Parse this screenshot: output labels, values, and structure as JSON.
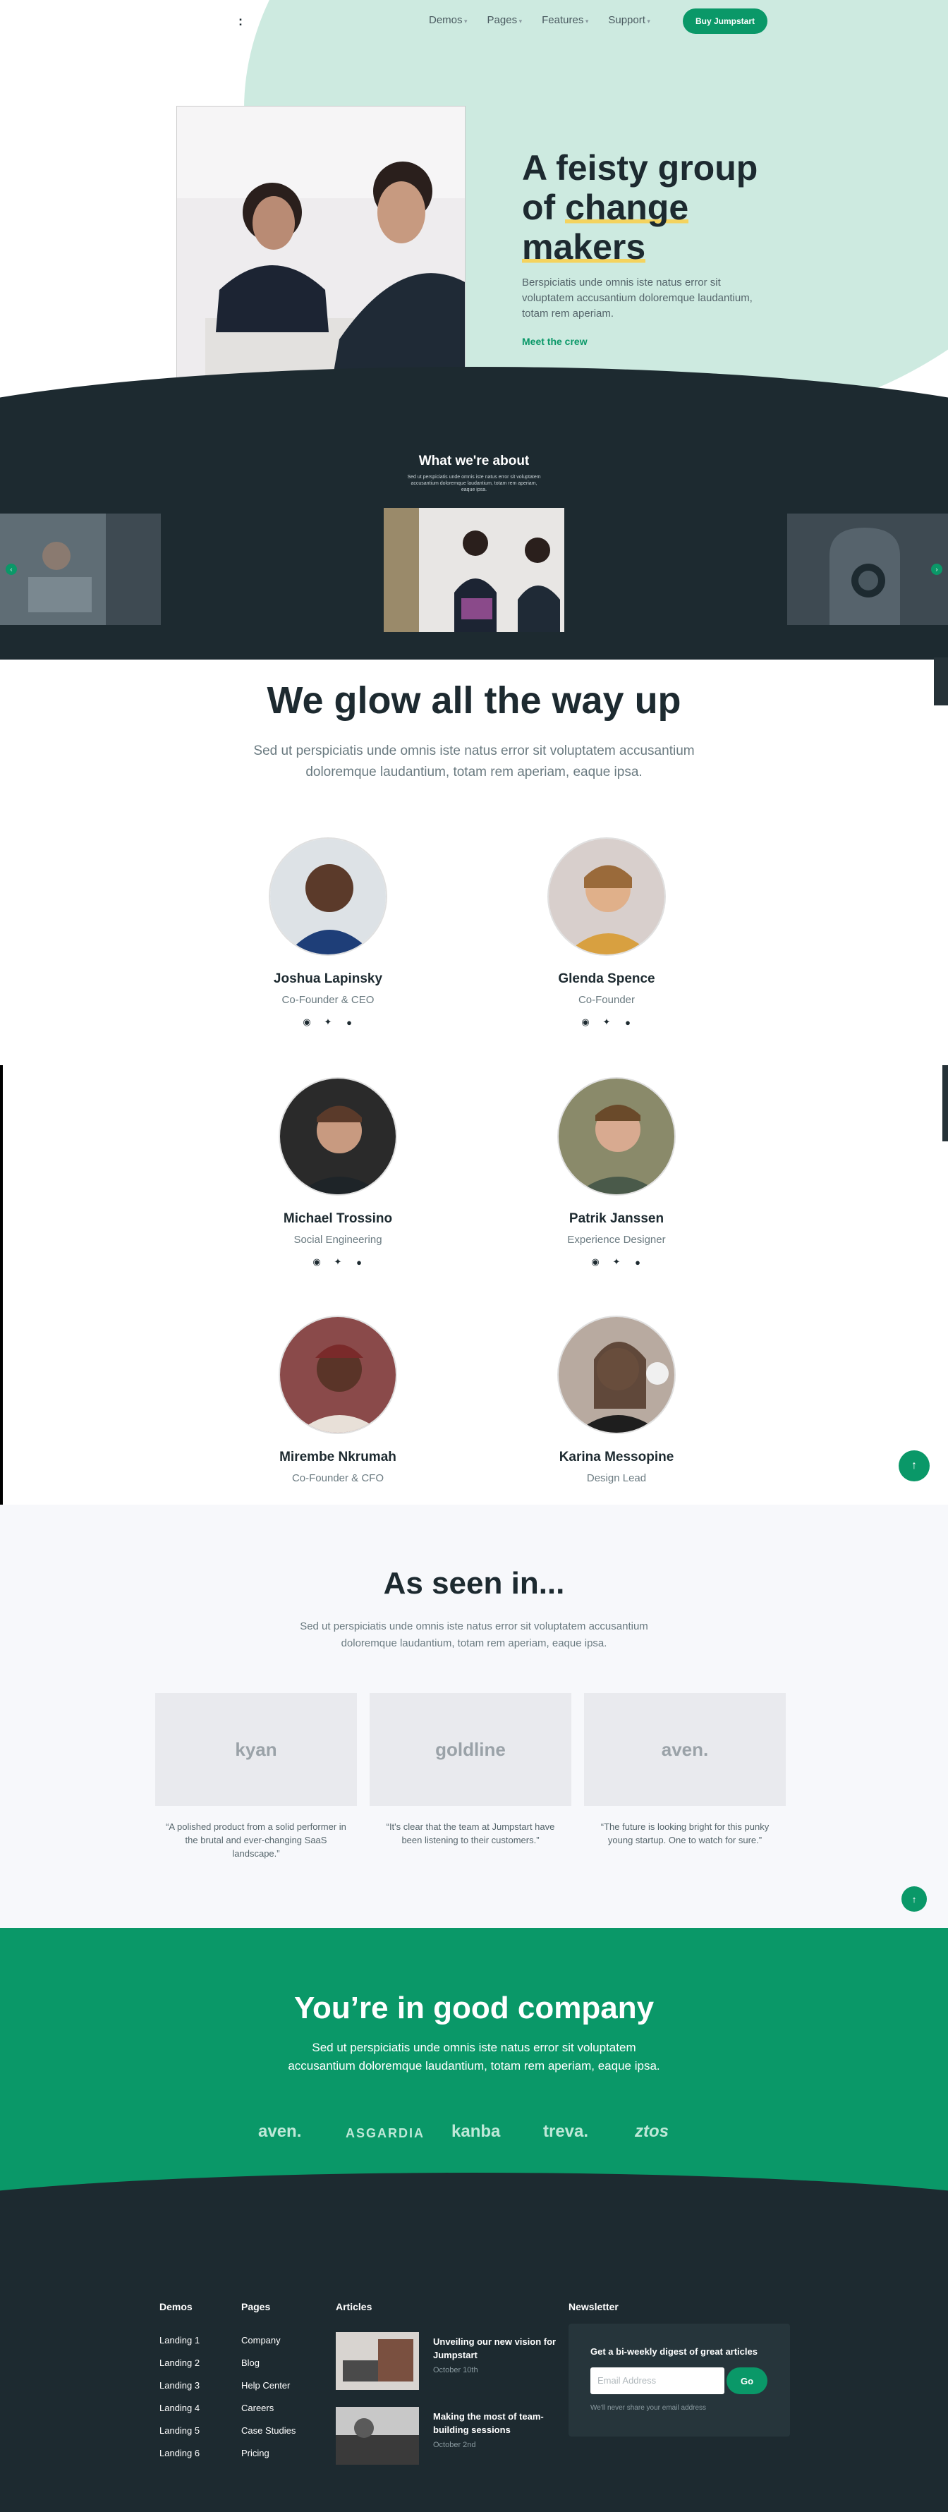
{
  "nav": {
    "logo": ":",
    "items": [
      {
        "label": "Demos"
      },
      {
        "label": "Pages"
      },
      {
        "label": "Features"
      },
      {
        "label": "Support"
      }
    ],
    "cta": "Buy Jumpstart"
  },
  "hero": {
    "title_line1": "A feisty group",
    "title_of": "of ",
    "title_change": "change",
    "title_makers": "makers",
    "text": "Berspiciatis unde omnis iste natus error sit voluptatem accusantium doloremque laudantium, totam rem aperiam.",
    "link": "Meet the crew"
  },
  "about": {
    "title": "What we're about",
    "subtitle": "Sed ut perspiciatis unde omnis iste natus error sit voluptatem accusantium doloremque laudantium, totam rem aperiam, eaque ipsa."
  },
  "team": {
    "title": "We glow all the way up",
    "subtitle": "Sed ut perspiciatis unde omnis iste natus error sit voluptatem accusantium doloremque laudantium, totam rem aperiam, eaque ipsa.",
    "members": [
      {
        "name": "Joshua Lapinsky",
        "role": "Co-Founder & CEO"
      },
      {
        "name": "Glenda Spence",
        "role": "Co-Founder"
      },
      {
        "name": "Michael Trossino",
        "role": "Social Engineering"
      },
      {
        "name": "Patrik Janssen",
        "role": "Experience Designer"
      },
      {
        "name": "Mirembe Nkrumah",
        "role": "Co-Founder & CFO"
      },
      {
        "name": "Karina Messopine",
        "role": "Design Lead"
      }
    ]
  },
  "press": {
    "title": "As seen in...",
    "subtitle": "Sed ut perspiciatis unde omnis iste natus error sit voluptatem accusantium doloremque laudantium, totam rem aperiam, eaque ipsa.",
    "logos": [
      "kyan",
      "goldline",
      "aven."
    ],
    "quotes": [
      "“A polished product from a solid performer in the brutal and ever-changing SaaS landscape.”",
      "“It's clear that the team at Jumpstart have been listening to their customers.”",
      "“The future is looking bright for this punky young startup. One to watch for sure.”"
    ]
  },
  "company": {
    "title": "You’re in good company",
    "subtitle": "Sed ut perspiciatis unde omnis iste natus error sit voluptatem accusantium doloremque laudantium, totam rem aperiam, eaque ipsa.",
    "logos": [
      "aven.",
      "ASGARDIA",
      "kanba",
      "treva.",
      "ztos"
    ]
  },
  "footer": {
    "demos_title": "Demos",
    "demos": [
      "Landing 1",
      "Landing 2",
      "Landing 3",
      "Landing 4",
      "Landing 5",
      "Landing 6"
    ],
    "pages_title": "Pages",
    "pages": [
      "Company",
      "Blog",
      "Help Center",
      "Careers",
      "Case Studies",
      "Pricing"
    ],
    "articles_title": "Articles",
    "articles": [
      {
        "title": "Unveiling our new vision for Jumpstart",
        "date": "October 10th"
      },
      {
        "title": "Making the most of team-building sessions",
        "date": "October 2nd"
      }
    ],
    "newsletter_title": "Newsletter",
    "newsletter_heading": "Get a bi-weekly digest of great articles",
    "email_placeholder": "Email Address",
    "go": "Go",
    "note": "We'll never share your email address"
  },
  "colors": {
    "accent": "#0a9868",
    "dark": "#1d2a30",
    "mint": "#cdeae0"
  },
  "icons": [
    "chevron-down-icon",
    "dribbble-icon",
    "twitter-icon",
    "github-icon",
    "arrow-up-icon",
    "chevron-left-icon",
    "chevron-right-icon"
  ]
}
